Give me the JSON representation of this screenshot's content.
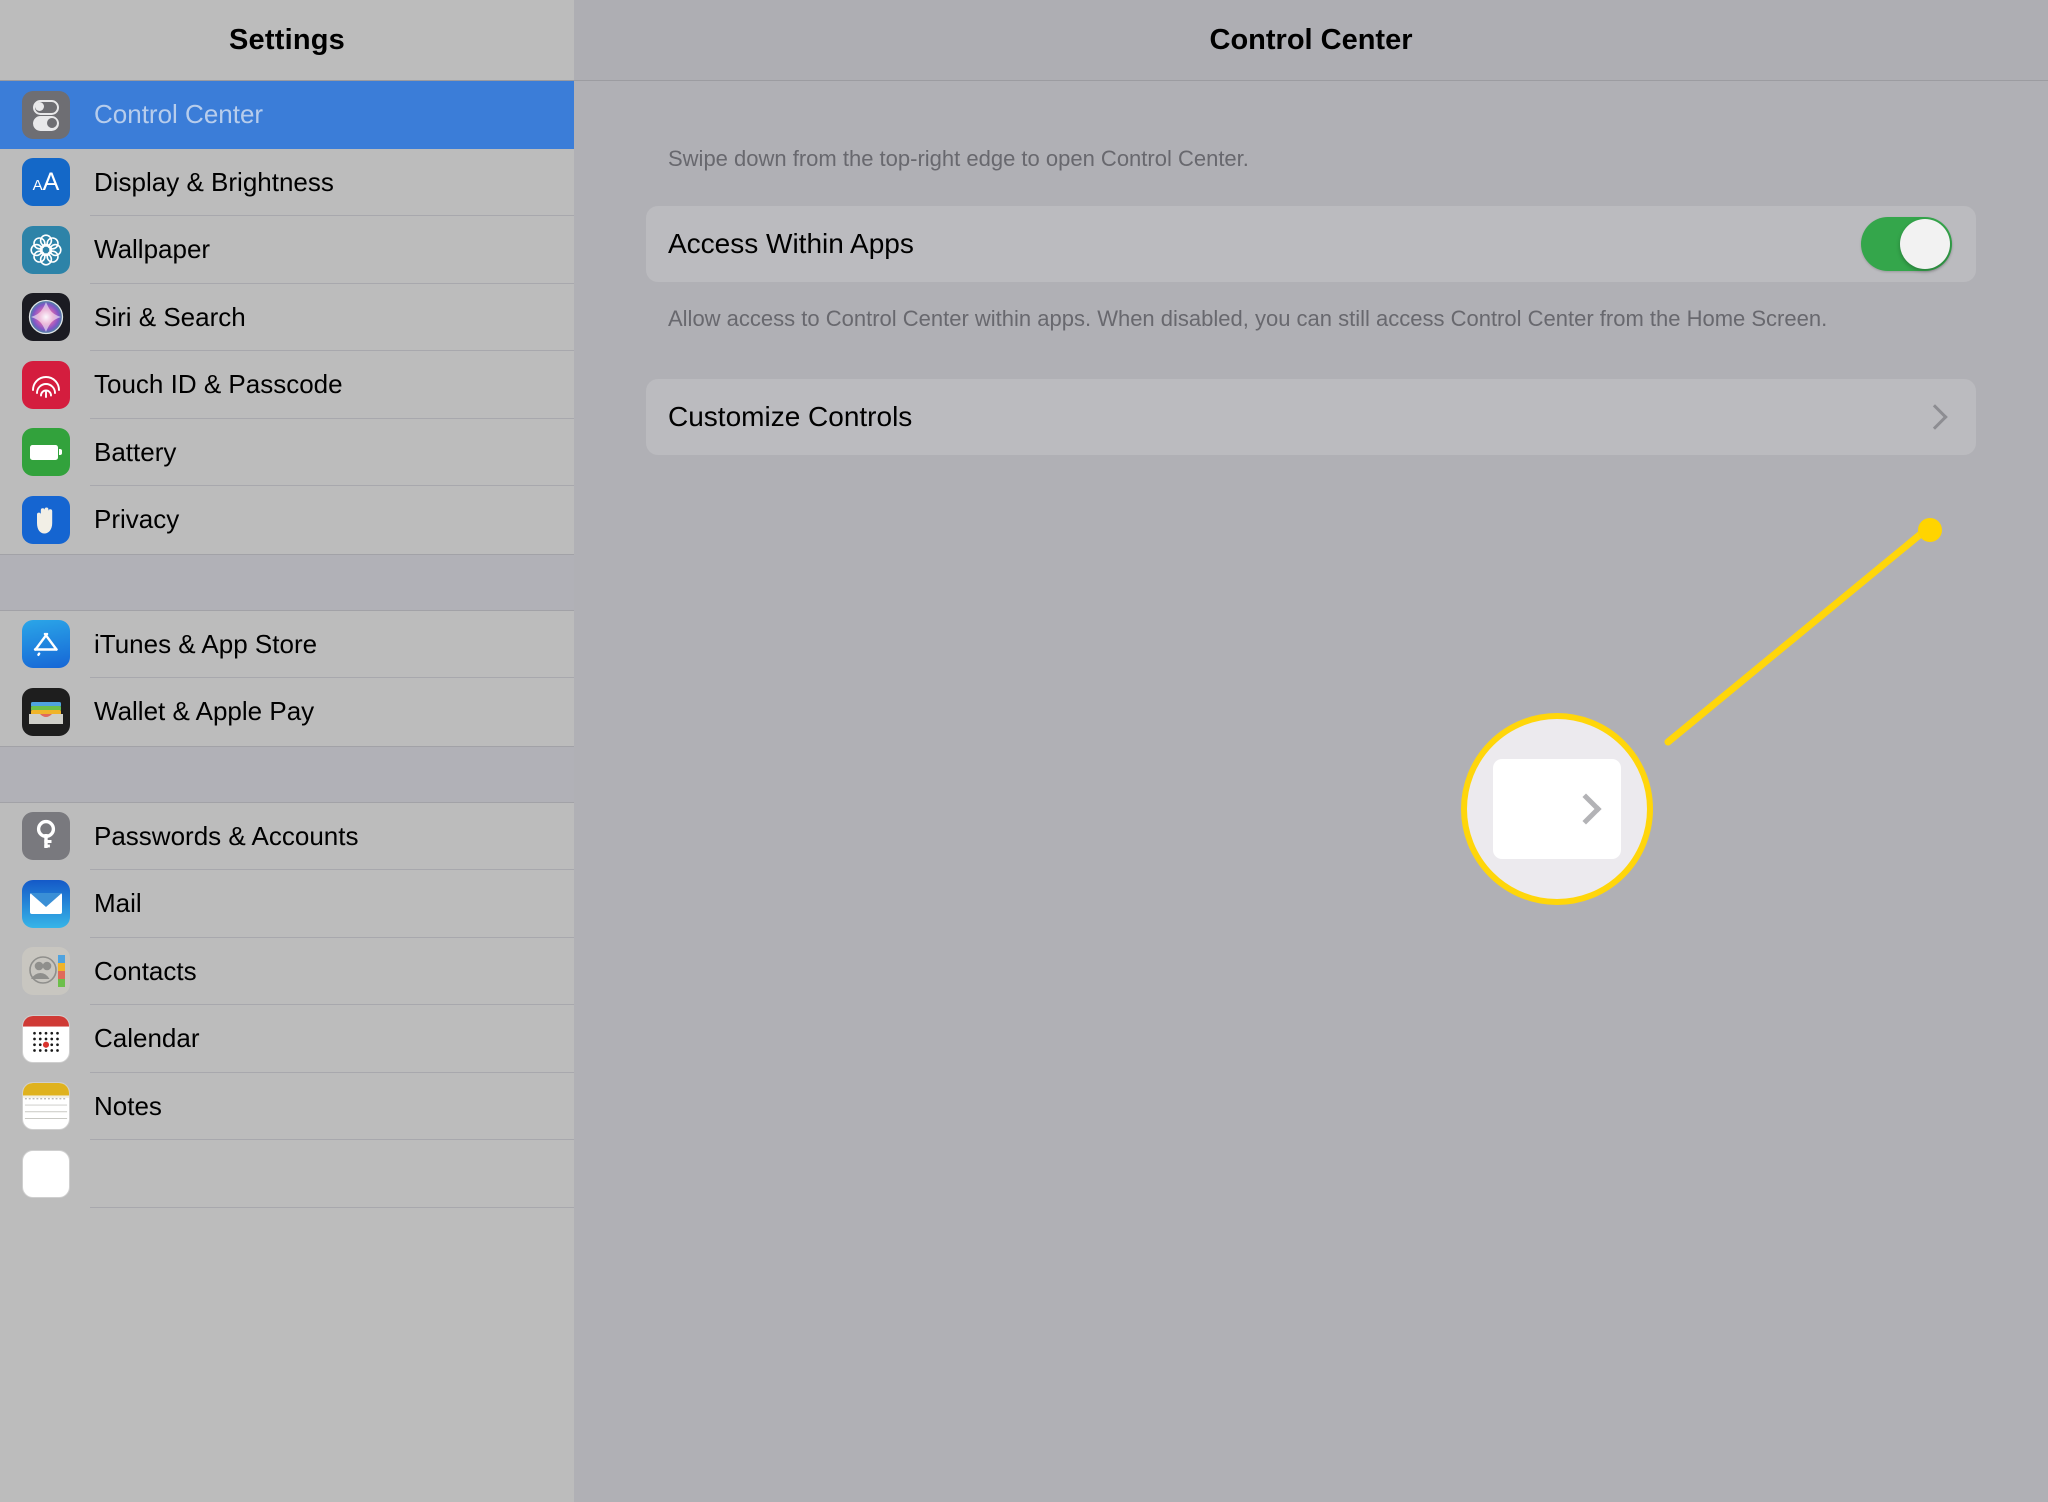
{
  "sidebar": {
    "title": "Settings",
    "groups": [
      {
        "items": [
          {
            "label": "Control Center",
            "icon": "control-center-icon",
            "selected": true
          },
          {
            "label": "Display & Brightness",
            "icon": "display-brightness-icon",
            "selected": false
          },
          {
            "label": "Wallpaper",
            "icon": "wallpaper-icon",
            "selected": false
          },
          {
            "label": "Siri & Search",
            "icon": "siri-search-icon",
            "selected": false
          },
          {
            "label": "Touch ID & Passcode",
            "icon": "touch-id-icon",
            "selected": false
          },
          {
            "label": "Battery",
            "icon": "battery-icon",
            "selected": false
          },
          {
            "label": "Privacy",
            "icon": "privacy-hand-icon",
            "selected": false
          }
        ]
      },
      {
        "items": [
          {
            "label": "iTunes & App Store",
            "icon": "app-store-icon",
            "selected": false
          },
          {
            "label": "Wallet & Apple Pay",
            "icon": "wallet-icon",
            "selected": false
          }
        ]
      },
      {
        "items": [
          {
            "label": "Passwords & Accounts",
            "icon": "key-icon",
            "selected": false
          },
          {
            "label": "Mail",
            "icon": "mail-envelope-icon",
            "selected": false
          },
          {
            "label": "Contacts",
            "icon": "contacts-icon",
            "selected": false
          },
          {
            "label": "Calendar",
            "icon": "calendar-icon",
            "selected": false
          },
          {
            "label": "Notes",
            "icon": "notes-icon",
            "selected": false
          }
        ]
      }
    ]
  },
  "detail": {
    "title": "Control Center",
    "swipe_note": "Swipe down from the top-right edge to open Control Center.",
    "access_within_apps": {
      "label": "Access Within Apps",
      "toggle_state": "on",
      "description": "Allow access to Control Center within apps. When disabled, you can still access Control Center from the Home Screen."
    },
    "customize_controls": {
      "label": "Customize Controls",
      "chevron": "chevron-right-icon"
    }
  },
  "annotation": {
    "callout_color": "#ffd60a",
    "magnifier_target": "chevron-right-icon"
  },
  "colors": {
    "selection_blue": "#3b7dd8",
    "toggle_green": "#34a64b",
    "callout_yellow": "#ffd60a",
    "sidebar_bg": "#bcbcbc",
    "detail_bg": "#b0b0b5",
    "card_bg": "#bbbbbf"
  }
}
